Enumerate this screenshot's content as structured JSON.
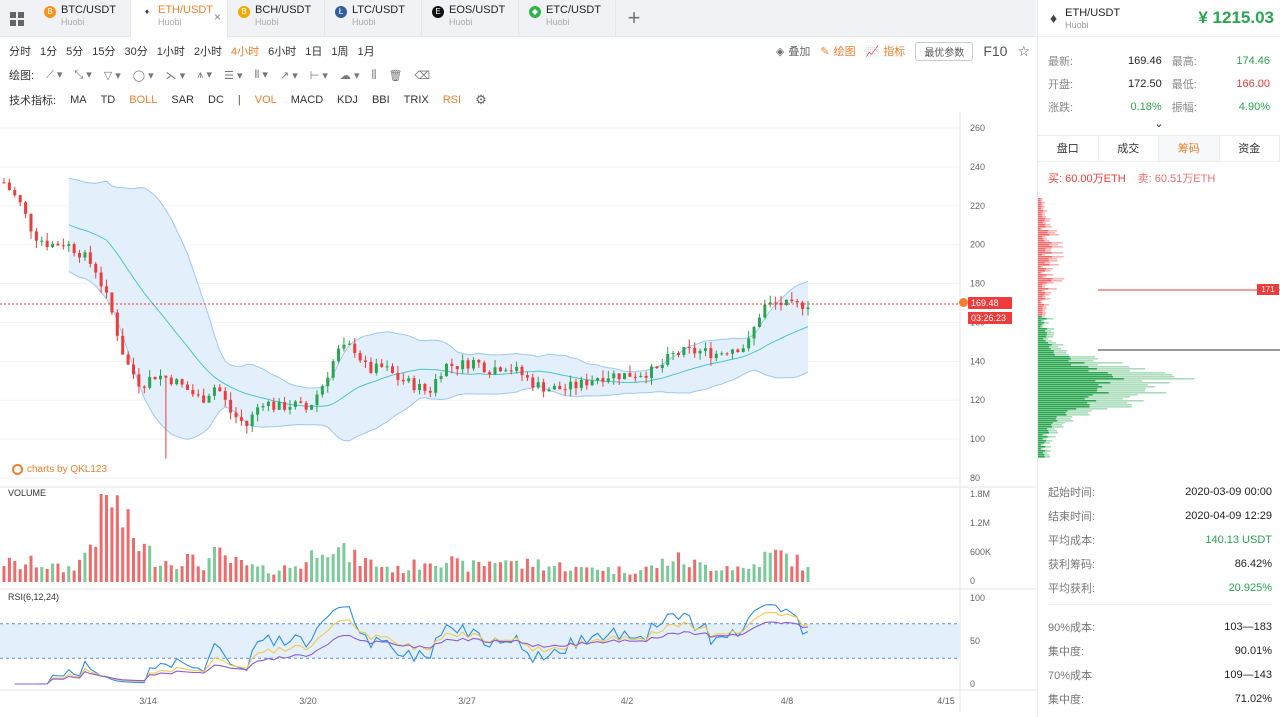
{
  "tabs": [
    {
      "name": "BTC/USDT",
      "exchange": "Huobi",
      "icon": "btc-icon",
      "color": "#f7931a",
      "glyph": "B"
    },
    {
      "name": "ETH/USDT",
      "exchange": "Huobi",
      "icon": "eth-icon",
      "color": "#ffffff",
      "glyph": "♦",
      "active": true
    },
    {
      "name": "BCH/USDT",
      "exchange": "Huobi",
      "icon": "bch-icon",
      "color": "#f2a900",
      "glyph": "B"
    },
    {
      "name": "LTC/USDT",
      "exchange": "Huobi",
      "icon": "ltc-icon",
      "color": "#345d9d",
      "glyph": "Ł"
    },
    {
      "name": "EOS/USDT",
      "exchange": "Huobi",
      "icon": "eos-icon",
      "color": "#111111",
      "glyph": "E"
    },
    {
      "name": "ETC/USDT",
      "exchange": "Huobi",
      "icon": "etc-icon",
      "color": "#33b34a",
      "glyph": "◆"
    }
  ],
  "periods": [
    "分时",
    "1分",
    "5分",
    "15分",
    "30分",
    "1小时",
    "2小时",
    "4小时",
    "6小时",
    "1日",
    "1周",
    "1月"
  ],
  "active_period": "4小时",
  "toolbar_right": {
    "overlay": "叠加",
    "draw": "绘图",
    "indicator": "指标",
    "optimal": "最优参数",
    "f10": "F10"
  },
  "draw_label": "绘图:",
  "indicator_label": "技术指标:",
  "indicators_main": [
    {
      "label": "MA",
      "on": false
    },
    {
      "label": "TD",
      "on": false
    },
    {
      "label": "BOLL",
      "on": true
    },
    {
      "label": "SAR",
      "on": false
    },
    {
      "label": "DC",
      "on": false
    }
  ],
  "indicators_sub": [
    {
      "label": "VOL",
      "on": true
    },
    {
      "label": "MACD",
      "on": false
    },
    {
      "label": "KDJ",
      "on": false
    },
    {
      "label": "BBI",
      "on": false
    },
    {
      "label": "TRIX",
      "on": false
    },
    {
      "label": "RSI",
      "on": true
    }
  ],
  "watermark": "charts by QKL123",
  "volume_label": "VOLUME",
  "rsi_label": "RSI(6,12,24)",
  "price_tag": "169.48",
  "countdown_tag": "03:26:23",
  "colors": {
    "up": "#2aa44f",
    "down": "#ee3b3b",
    "accent": "#f08030",
    "band": "#9cc8ee"
  },
  "chart_data": {
    "type": "candlestick",
    "price_axis": {
      "ticks": [
        "260",
        "240",
        "220",
        "200",
        "180",
        "160",
        "140",
        "120",
        "100",
        "80"
      ],
      "ylim": [
        80,
        260
      ]
    },
    "volume_axis": {
      "ticks": [
        "1.8M",
        "1.2M",
        "600K",
        "0"
      ]
    },
    "rsi_axis": {
      "ticks": [
        "100",
        "50",
        "0"
      ],
      "bands": [
        30,
        70
      ]
    },
    "x_ticks": [
      "3/14",
      "3/20",
      "3/27",
      "4/2",
      "4/8",
      "4/15"
    ],
    "close_anchors": [
      232,
      222,
      205,
      200,
      201,
      196,
      188,
      168,
      140,
      128,
      133,
      131,
      126,
      120,
      128,
      113,
      107,
      120,
      116,
      118,
      115,
      128,
      145,
      148,
      135,
      137,
      131,
      128,
      124,
      138,
      138,
      140,
      136,
      138,
      134,
      128,
      126,
      126,
      128,
      132,
      133,
      133,
      134,
      135,
      143,
      145,
      145,
      144,
      147,
      148,
      168,
      170,
      168,
      170
    ],
    "vol_anchors": [
      0.25,
      0.2,
      0.25,
      0.2,
      0.15,
      0.25,
      0.6,
      1.1,
      0.7,
      0.45,
      0.3,
      0.25,
      0.3,
      0.2,
      0.35,
      0.25,
      0.2,
      0.15,
      0.15,
      0.2,
      0.25,
      0.55,
      0.4,
      0.3,
      0.25,
      0.2,
      0.15,
      0.2,
      0.3,
      0.3,
      0.2,
      0.2,
      0.25,
      0.3,
      0.2,
      0.25,
      0.2,
      0.2,
      0.15,
      0.2,
      0.15,
      0.15,
      0.15,
      0.2,
      0.3,
      0.25,
      0.2,
      0.2,
      0.2,
      0.15,
      0.3,
      0.35,
      0.3,
      0.15
    ],
    "last_price": 169.48,
    "cost_line_label": "171"
  },
  "right_panel": {
    "symbol": "ETH/USDT",
    "exchange": "Huobi",
    "price": "¥ 1215.03",
    "stats": [
      {
        "k": "最新:",
        "v": "169.46",
        "k2": "最高:",
        "v2": "174.46",
        "c2": "#2aa44f"
      },
      {
        "k": "开盘:",
        "v": "172.50",
        "k2": "最低:",
        "v2": "166.00",
        "c2": "#ee3b3b"
      },
      {
        "k": "涨跌:",
        "v": "0.18%",
        "vc": "#2aa44f",
        "k2": "振幅:",
        "v2": "4.90%",
        "c2": "#2aa44f"
      }
    ],
    "tabs": [
      "盘口",
      "成交",
      "筹码",
      "资金"
    ],
    "active_tab": "筹码",
    "buy": "买: 60.00万ETH",
    "sell": "卖: 60.51万ETH",
    "info": [
      {
        "k": "起始时间:",
        "v": "2020-03-09 00:00"
      },
      {
        "k": "结束时间:",
        "v": "2020-04-09 12:29"
      },
      {
        "k": "平均成本:",
        "v": "140.13 USDT",
        "green": true
      },
      {
        "k": "获利筹码:",
        "v": "86.42%"
      },
      {
        "k": "平均获利:",
        "v": "20.925%",
        "green": true
      }
    ],
    "info2": [
      {
        "k": "90%成本:",
        "v": "103—183"
      },
      {
        "k": "集中度:",
        "v": "90.01%"
      },
      {
        "k": "70%成本",
        "v": "109—143"
      },
      {
        "k": "集中度:",
        "v": "71.02%"
      }
    ]
  }
}
